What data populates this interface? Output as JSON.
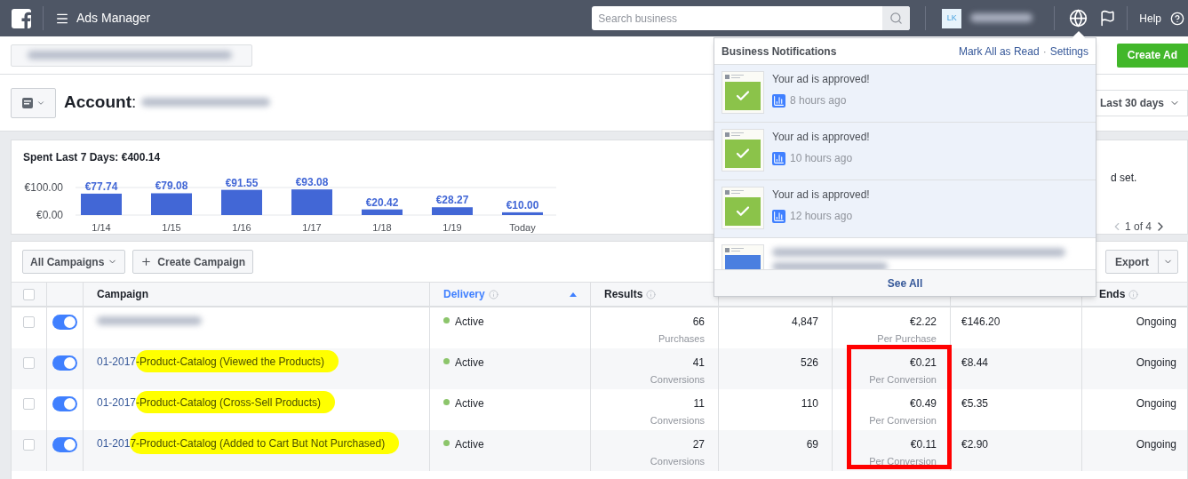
{
  "top_bar": {
    "app_title": "Ads Manager",
    "search": {
      "placeholder": "Search business"
    },
    "avatar": "LK",
    "help": "Help"
  },
  "create_ad": "Create Ad",
  "account": {
    "label": "Account",
    "separator": ":"
  },
  "date_range": "Last 30 days",
  "spend_chart": {
    "chart_data": {
      "type": "bar",
      "title": "Spent Last 7 Days: €400.14",
      "categories": [
        "1/14",
        "1/15",
        "1/16",
        "1/17",
        "1/18",
        "1/19",
        "Today"
      ],
      "values": [
        77.74,
        79.08,
        91.55,
        93.08,
        20.42,
        28.27,
        10.0
      ],
      "value_labels": [
        "€77.74",
        "€79.08",
        "€91.55",
        "€93.08",
        "€20.42",
        "€28.27",
        "€10.00"
      ],
      "yticks": [
        {
          "value": 0,
          "label": "€0.00"
        },
        {
          "value": 100,
          "label": "€100.00"
        }
      ],
      "ylim": [
        0,
        100
      ]
    }
  },
  "side_note": "d set.",
  "pager": "1 of 4",
  "toolbar": {
    "filter": "All Campaigns",
    "create": "Create Campaign",
    "export": "Export"
  },
  "table": {
    "all_checked": false,
    "columns": [
      {
        "label": "Campaign",
        "sorted": false
      },
      {
        "label": "Delivery",
        "sorted": true
      },
      {
        "label": "Results",
        "sorted": false
      },
      {
        "label": "Ends",
        "sorted": false
      }
    ],
    "rows": [
      {
        "kind": "blurred",
        "on": true,
        "checked": false,
        "delivery": "Active",
        "color": "#8cc56b",
        "results": "66",
        "results_unit": "Purchases",
        "reach": "4,847",
        "cost": "€2.22",
        "cost_unit": "Per Purchase",
        "flagged": false,
        "spent": "€146.20",
        "ends": "Ongoing"
      },
      {
        "kind": "named",
        "name_prefix": "01-2017",
        "name_highlight": "-Product-Catalog (Viewed the Products)",
        "on": true,
        "checked": false,
        "delivery": "Active",
        "color": "#8cc56b",
        "results": "41",
        "results_unit": "Conversions",
        "reach": "526",
        "cost": "€0.21",
        "cost_unit": "Per Conversion",
        "flagged": true,
        "spent": "€8.44",
        "ends": "Ongoing"
      },
      {
        "kind": "named",
        "name_prefix": "01-2017",
        "name_highlight": "-Product-Catalog (Cross-Sell Products)",
        "on": true,
        "checked": false,
        "delivery": "Active",
        "color": "#8cc56b",
        "results": "11",
        "results_unit": "Conversions",
        "reach": "110",
        "cost": "€0.49",
        "cost_unit": "Per Conversion",
        "flagged": true,
        "spent": "€5.35",
        "ends": "Ongoing"
      },
      {
        "kind": "named",
        "name_prefix": "01-201",
        "name_highlight": "7-Product-Catalog (Added to Cart But Not Purchased)",
        "on": true,
        "checked": false,
        "delivery": "Active",
        "color": "#8cc56b",
        "results": "27",
        "results_unit": "Conversions",
        "reach": "69",
        "cost": "€0.11",
        "cost_unit": "Per Conversion",
        "flagged": true,
        "spent": "€2.90",
        "ends": "Ongoing"
      }
    ]
  },
  "notifications": {
    "title": "Business Notifications",
    "mark_all": "Mark All as Read",
    "separator": "·",
    "settings": "Settings",
    "see_all": "See All",
    "items": [
      {
        "kind": "approved",
        "text": "Your ad is approved!",
        "time": "8 hours ago",
        "unread": true
      },
      {
        "kind": "approved",
        "text": "Your ad is approved!",
        "time": "10 hours ago",
        "unread": true
      },
      {
        "kind": "approved",
        "text": "Your ad is approved!",
        "time": "12 hours ago",
        "unread": true
      },
      {
        "kind": "blurred",
        "unread": false
      }
    ]
  }
}
